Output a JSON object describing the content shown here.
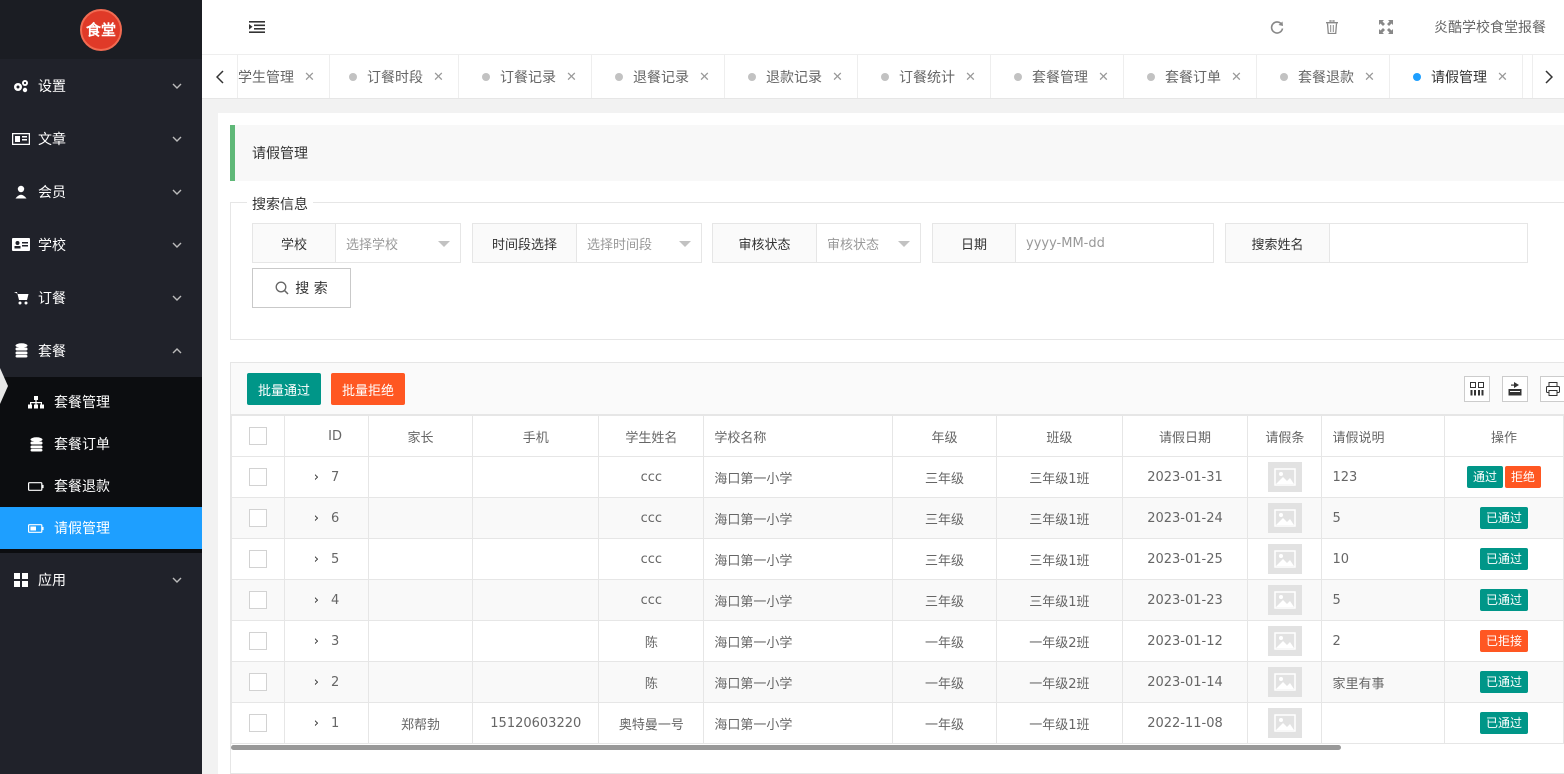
{
  "logo_text": "食堂",
  "sidebar": {
    "items": [
      {
        "label": "设置",
        "icon": "gears-icon"
      },
      {
        "label": "文章",
        "icon": "newspaper-icon"
      },
      {
        "label": "会员",
        "icon": "user-icon"
      },
      {
        "label": "学校",
        "icon": "id-card-icon"
      },
      {
        "label": "订餐",
        "icon": "cart-icon"
      },
      {
        "label": "套餐",
        "icon": "database-icon"
      }
    ],
    "sub_items": [
      {
        "label": "套餐管理",
        "icon": "sitemap-icon"
      },
      {
        "label": "套餐订单",
        "icon": "database-icon"
      },
      {
        "label": "套餐退款",
        "icon": "battery-empty-icon"
      },
      {
        "label": "请假管理",
        "icon": "battery-half-icon"
      }
    ],
    "last_item": {
      "label": "应用",
      "icon": "grid-icon"
    }
  },
  "header": {
    "title": "炎酷学校食堂报餐"
  },
  "tabs": [
    {
      "label": "学生管理"
    },
    {
      "label": "订餐时段"
    },
    {
      "label": "订餐记录"
    },
    {
      "label": "退餐记录"
    },
    {
      "label": "退款记录"
    },
    {
      "label": "订餐统计"
    },
    {
      "label": "套餐管理"
    },
    {
      "label": "套餐订单"
    },
    {
      "label": "套餐退款"
    },
    {
      "label": "请假管理"
    }
  ],
  "page": {
    "heading": "请假管理",
    "search_legend": "搜索信息",
    "search": {
      "school_label": "学校",
      "school_placeholder": "选择学校",
      "period_label": "时间段选择",
      "period_placeholder": "选择时间段",
      "status_label": "审核状态",
      "status_placeholder": "审核状态",
      "date_label": "日期",
      "date_placeholder": "yyyy-MM-dd",
      "name_label": "搜索姓名",
      "name_value": "",
      "button": "搜 索"
    },
    "toolbar": {
      "batch_pass": "批量通过",
      "batch_reject": "批量拒绝"
    },
    "columns": [
      "ID",
      "家长",
      "手机",
      "学生姓名",
      "学校名称",
      "年级",
      "班级",
      "请假日期",
      "请假条",
      "请假说明",
      "操作"
    ],
    "rows": [
      {
        "id": "7",
        "parent": "",
        "phone": "",
        "student": "ccc",
        "school": "海口第一小学",
        "grade": "三年级",
        "class": "三年级1班",
        "date": "2023-01-31",
        "note": "123",
        "status": "pending"
      },
      {
        "id": "6",
        "parent": "",
        "phone": "",
        "student": "ccc",
        "school": "海口第一小学",
        "grade": "三年级",
        "class": "三年级1班",
        "date": "2023-01-24",
        "note": "5",
        "status": "passed"
      },
      {
        "id": "5",
        "parent": "",
        "phone": "",
        "student": "ccc",
        "school": "海口第一小学",
        "grade": "三年级",
        "class": "三年级1班",
        "date": "2023-01-25",
        "note": "10",
        "status": "passed"
      },
      {
        "id": "4",
        "parent": "",
        "phone": "",
        "student": "ccc",
        "school": "海口第一小学",
        "grade": "三年级",
        "class": "三年级1班",
        "date": "2023-01-23",
        "note": "5",
        "status": "passed"
      },
      {
        "id": "3",
        "parent": "",
        "phone": "",
        "student": "陈",
        "school": "海口第一小学",
        "grade": "一年级",
        "class": "一年级2班",
        "date": "2023-01-12",
        "note": "2",
        "status": "rejected"
      },
      {
        "id": "2",
        "parent": "",
        "phone": "",
        "student": "陈",
        "school": "海口第一小学",
        "grade": "一年级",
        "class": "一年级2班",
        "date": "2023-01-14",
        "note": "家里有事",
        "status": "passed"
      },
      {
        "id": "1",
        "parent": "郑帮勃",
        "phone": "15120603220",
        "student": "奥特曼一号",
        "school": "海口第一小学",
        "grade": "一年级",
        "class": "一年级1班",
        "date": "2022-11-08",
        "note": "",
        "status": "passed"
      }
    ],
    "actions": {
      "pass": "通过",
      "reject": "拒绝",
      "passed": "已通过",
      "rejected": "已拒接"
    }
  },
  "colors": {
    "sidebar_bg": "#20222a",
    "active_blue": "#1e9fff",
    "green": "#009688",
    "orange": "#ff5722",
    "heading_accent": "#5fb878"
  }
}
